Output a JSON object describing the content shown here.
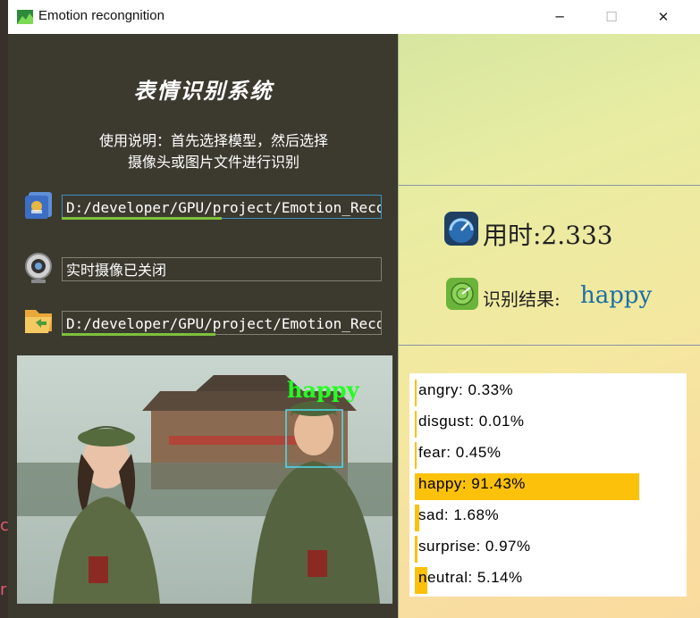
{
  "window": {
    "title": "Emotion recongnition",
    "minimize": "─",
    "maximize": "☐",
    "close": "✕"
  },
  "left_panel": {
    "title": "表情识别系统",
    "instructions_line1": "使用说明：首先选择模型，然后选择",
    "instructions_line2": "摄像头或图片文件进行识别",
    "model_path": "D:/developer/GPU/project/Emotion_Recognition",
    "camera_status": "实时摄像已关闭",
    "image_path": "D:/developer/GPU/project/Emotion_Recognition",
    "model_progress_pct": 50,
    "image_progress_pct": 48,
    "detection_label": "happy"
  },
  "right_panel": {
    "time_text": "用时:2.333",
    "result_label": "识别结果:",
    "result_value": "happy"
  },
  "probabilities": [
    {
      "label": "angry: 0.33%",
      "value": 0.33
    },
    {
      "label": "disgust: 0.01%",
      "value": 0.01
    },
    {
      "label": "fear: 0.45%",
      "value": 0.45
    },
    {
      "label": "happy: 91.43%",
      "value": 91.43
    },
    {
      "label": "sad: 1.68%",
      "value": 1.68
    },
    {
      "label": "surprise: 0.97%",
      "value": 0.97
    },
    {
      "label": "neutral: 5.14%",
      "value": 5.14
    }
  ],
  "colors": {
    "bar": "#fcc10b",
    "accent_line": "#7fc13c",
    "detect_box": "#4fdcf0",
    "detect_text": "#22ff22"
  },
  "icons": [
    "app-icon",
    "folder-model-icon",
    "webcam-icon",
    "folder-open-icon",
    "speedometer-icon",
    "radar-icon"
  ],
  "background_fragments": {
    "a": "c",
    "b": "r"
  }
}
